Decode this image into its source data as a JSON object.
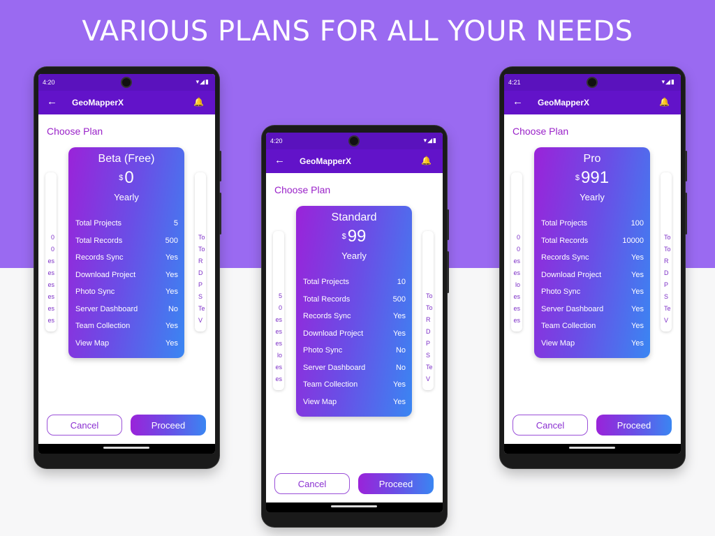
{
  "headline": "VARIOUS PLANS FOR ALL YOUR NEEDS",
  "screens": [
    {
      "time": "4:20",
      "app_title": "GeoMapperX",
      "heading": "Choose Plan",
      "plan_name": "Beta (Free)",
      "currency": "$",
      "price": "0",
      "period": "Yearly",
      "features": [
        {
          "label": "Total Projects",
          "value": "5"
        },
        {
          "label": "Total Records",
          "value": "500"
        },
        {
          "label": "Records Sync",
          "value": "Yes"
        },
        {
          "label": "Download Project",
          "value": "Yes"
        },
        {
          "label": "Photo Sync",
          "value": "Yes"
        },
        {
          "label": "Server Dashboard",
          "value": "No"
        },
        {
          "label": "Team Collection",
          "value": "Yes"
        },
        {
          "label": "View Map",
          "value": "Yes"
        }
      ],
      "ghost_left": [
        "0",
        "0",
        "es",
        "es",
        "es",
        "es",
        "es",
        "es"
      ],
      "ghost_right": [
        "To",
        "To",
        "R",
        "D",
        "P",
        "S",
        "Te",
        "V"
      ],
      "cancel_label": "Cancel",
      "proceed_label": "Proceed"
    },
    {
      "time": "4:20",
      "app_title": "GeoMapperX",
      "heading": "Choose Plan",
      "plan_name": "Standard",
      "currency": "$",
      "price": "99",
      "period": "Yearly",
      "features": [
        {
          "label": "Total Projects",
          "value": "10"
        },
        {
          "label": "Total Records",
          "value": "500"
        },
        {
          "label": "Records Sync",
          "value": "Yes"
        },
        {
          "label": "Download Project",
          "value": "Yes"
        },
        {
          "label": "Photo Sync",
          "value": "No"
        },
        {
          "label": "Server Dashboard",
          "value": "No"
        },
        {
          "label": "Team Collection",
          "value": "Yes"
        },
        {
          "label": "View Map",
          "value": "Yes"
        }
      ],
      "ghost_left": [
        "5",
        "0",
        "es",
        "es",
        "es",
        "lo",
        "es",
        "es"
      ],
      "ghost_right": [
        "To",
        "To",
        "R",
        "D",
        "P",
        "S",
        "Te",
        "V"
      ],
      "cancel_label": "Cancel",
      "proceed_label": "Proceed"
    },
    {
      "time": "4:21",
      "app_title": "GeoMapperX",
      "heading": "Choose Plan",
      "plan_name": "Pro",
      "currency": "$",
      "price": "991",
      "period": "Yearly",
      "features": [
        {
          "label": "Total Projects",
          "value": "100"
        },
        {
          "label": "Total Records",
          "value": "10000"
        },
        {
          "label": "Records Sync",
          "value": "Yes"
        },
        {
          "label": "Download Project",
          "value": "Yes"
        },
        {
          "label": "Photo Sync",
          "value": "Yes"
        },
        {
          "label": "Server Dashboard",
          "value": "Yes"
        },
        {
          "label": "Team Collection",
          "value": "Yes"
        },
        {
          "label": "View Map",
          "value": "Yes"
        }
      ],
      "ghost_left": [
        "0",
        "0",
        "es",
        "es",
        "lo",
        "es",
        "es",
        "es"
      ],
      "ghost_right": [
        "To",
        "To",
        "R",
        "D",
        "P",
        "S",
        "Te",
        "V"
      ],
      "cancel_label": "Cancel",
      "proceed_label": "Proceed"
    }
  ],
  "colors": {
    "background_top": "#9a6af1",
    "status_bar": "#5a12bd",
    "app_bar": "#6213c9",
    "accent_text": "#9a22c9",
    "gradient_start": "#9a23d9",
    "gradient_end": "#3a86f2"
  },
  "icons": {
    "back": "back-arrow-icon",
    "notification": "bell-icon",
    "wifi": "wifi-icon",
    "signal": "signal-icon",
    "battery": "battery-icon"
  }
}
